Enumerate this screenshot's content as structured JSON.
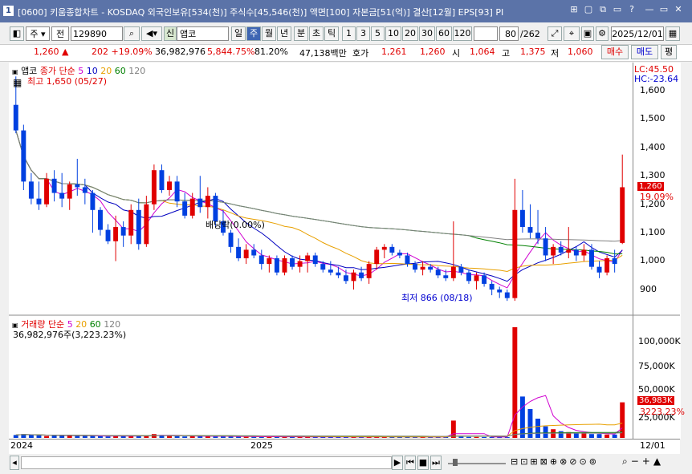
{
  "window": {
    "app_num": "1",
    "title": "[0600] 키움종합차트 - KOSDAQ 외국인보유[534(천)] 주식수[45,546(천)] 액면[100] 자본금[51(억)] 결산[12월] EPS[93] PI",
    "buttons": [
      "⊞",
      "▢",
      "⧉",
      "▭",
      "?",
      "—",
      "▭",
      "✕"
    ]
  },
  "toolbar": {
    "period_label": "주",
    "scope_label": "전",
    "code": "129890",
    "badge": "신",
    "name": "앱코",
    "periods": [
      "일",
      "주",
      "월",
      "년",
      "분",
      "초",
      "틱"
    ],
    "active_period": "주",
    "intervals": [
      "1",
      "3",
      "5",
      "10",
      "20",
      "30",
      "60",
      "120"
    ],
    "count": "80",
    "total": "/262",
    "date": "2025/12/01"
  },
  "quote": {
    "price": "1,260",
    "change": "202",
    "change_pct": "+19.09%",
    "volume": "36,982,976",
    "vol_pct": "5,844.75%",
    "ratio": "81.20%",
    "amount": "47,138백만",
    "bid_label": "호가",
    "bid1": "1,261",
    "bid2": "1,260",
    "open_label": "시",
    "open": "1,064",
    "high_label": "고",
    "high": "1,375",
    "low_label": "저",
    "low": "1,060",
    "buy": "매수",
    "sell": "매도",
    "avg": "평"
  },
  "price_panel": {
    "legend_name": "앱코",
    "legend_ma": "종가 단순",
    "ma": [
      "5",
      "10",
      "20",
      "60",
      "120"
    ],
    "ma_colors": [
      "#d000d0",
      "#0000c0",
      "#e8a000",
      "#008000",
      "#808080"
    ],
    "high_note": "최고 1,650 (05/27)",
    "low_note": "최저 866 (08/18)",
    "dividend_note": "배당락(0.00%)",
    "lc": "LC:45.50",
    "hc": "HC:-23.64",
    "yticks": [
      "1,600",
      "1,500",
      "1,400",
      "1,300",
      "1,200",
      "1,100",
      "1,000",
      "900"
    ],
    "last_price": "1,260",
    "last_pct": "19.09%"
  },
  "volume_panel": {
    "legend_name": "거래량",
    "legend_ma": "단순",
    "ma": [
      "5",
      "20",
      "60",
      "120"
    ],
    "ma_colors": [
      "#d000d0",
      "#e8a000",
      "#008000",
      "#808080"
    ],
    "vol_text": "36,982,976주(3,223.23%)",
    "yticks": [
      "100,000K",
      "75,000K",
      "50,000K",
      "25,000K"
    ],
    "last_vol": "36,983K",
    "last_pct": "3223.23%"
  },
  "xaxis": {
    "labels": [
      "2024",
      "2025"
    ],
    "right_label": "12/01"
  },
  "chart_data": {
    "type": "candlestick",
    "title": "앱코",
    "period": "weekly",
    "ylim": [
      850,
      1650
    ],
    "ohlc": [
      [
        1550,
        1650,
        1450,
        1460
      ],
      [
        1460,
        1480,
        1250,
        1280
      ],
      [
        1280,
        1310,
        1200,
        1220
      ],
      [
        1220,
        1280,
        1180,
        1200
      ],
      [
        1200,
        1310,
        1190,
        1290
      ],
      [
        1290,
        1320,
        1210,
        1240
      ],
      [
        1240,
        1310,
        1190,
        1220
      ],
      [
        1220,
        1280,
        1180,
        1270
      ],
      [
        1270,
        1360,
        1230,
        1260
      ],
      [
        1260,
        1290,
        1200,
        1240
      ],
      [
        1240,
        1250,
        1100,
        1180
      ],
      [
        1180,
        1190,
        1090,
        1110
      ],
      [
        1110,
        1130,
        1060,
        1070
      ],
      [
        1070,
        1160,
        1000,
        1120
      ],
      [
        1120,
        1140,
        1050,
        1090
      ],
      [
        1090,
        1200,
        1060,
        1180
      ],
      [
        1180,
        1220,
        1040,
        1060
      ],
      [
        1060,
        1230,
        1050,
        1200
      ],
      [
        1200,
        1340,
        1180,
        1320
      ],
      [
        1320,
        1340,
        1240,
        1250
      ],
      [
        1250,
        1300,
        1230,
        1280
      ],
      [
        1280,
        1300,
        1190,
        1210
      ],
      [
        1210,
        1240,
        1150,
        1160
      ],
      [
        1160,
        1240,
        1150,
        1220
      ],
      [
        1220,
        1300,
        1170,
        1190
      ],
      [
        1190,
        1260,
        1150,
        1230
      ],
      [
        1230,
        1240,
        1120,
        1140
      ],
      [
        1140,
        1180,
        1090,
        1100
      ],
      [
        1100,
        1110,
        1030,
        1050
      ],
      [
        1050,
        1080,
        1000,
        1010
      ],
      [
        1010,
        1060,
        990,
        1040
      ],
      [
        1040,
        1060,
        1010,
        1020
      ],
      [
        1020,
        1040,
        970,
        990
      ],
      [
        990,
        1020,
        960,
        1010
      ],
      [
        1010,
        1020,
        950,
        960
      ],
      [
        960,
        1020,
        950,
        1010
      ],
      [
        1010,
        1020,
        970,
        980
      ],
      [
        980,
        1020,
        960,
        1000
      ],
      [
        1000,
        1030,
        960,
        1020
      ],
      [
        1020,
        1030,
        980,
        990
      ],
      [
        990,
        1000,
        960,
        970
      ],
      [
        970,
        1000,
        950,
        960
      ],
      [
        960,
        980,
        940,
        950
      ],
      [
        950,
        970,
        920,
        930
      ],
      [
        930,
        970,
        900,
        960
      ],
      [
        960,
        980,
        930,
        940
      ],
      [
        940,
        1000,
        920,
        990
      ],
      [
        990,
        1050,
        970,
        1040
      ],
      [
        1040,
        1060,
        1010,
        1050
      ],
      [
        1050,
        1060,
        1020,
        1030
      ],
      [
        1030,
        1040,
        1010,
        1020
      ],
      [
        1020,
        1030,
        980,
        990
      ],
      [
        990,
        1000,
        960,
        970
      ],
      [
        970,
        1000,
        950,
        980
      ],
      [
        980,
        990,
        960,
        970
      ],
      [
        970,
        980,
        940,
        950
      ],
      [
        950,
        970,
        930,
        940
      ],
      [
        940,
        1140,
        930,
        980
      ],
      [
        980,
        990,
        950,
        960
      ],
      [
        960,
        970,
        920,
        930
      ],
      [
        930,
        960,
        900,
        950
      ],
      [
        950,
        960,
        910,
        920
      ],
      [
        920,
        930,
        880,
        900
      ],
      [
        900,
        910,
        870,
        890
      ],
      [
        890,
        900,
        860,
        870
      ],
      [
        870,
        1290,
        860,
        1180
      ],
      [
        1180,
        1250,
        1100,
        1120
      ],
      [
        1120,
        1200,
        1080,
        1100
      ],
      [
        1100,
        1180,
        1060,
        1080
      ],
      [
        1080,
        1120,
        1000,
        1020
      ],
      [
        1020,
        1060,
        990,
        1050
      ],
      [
        1050,
        1070,
        1020,
        1030
      ],
      [
        1030,
        1120,
        1010,
        1040
      ],
      [
        1040,
        1050,
        1000,
        1020
      ],
      [
        1020,
        1060,
        1000,
        1040
      ],
      [
        1040,
        1060,
        970,
        980
      ],
      [
        980,
        1000,
        940,
        960
      ],
      [
        960,
        1020,
        950,
        1010
      ],
      [
        1010,
        1040,
        960,
        990
      ],
      [
        1064,
        1375,
        1060,
        1260
      ]
    ],
    "volume_k": [
      3000,
      4000,
      3000,
      2500,
      2000,
      2500,
      3000,
      2500,
      2000,
      2000,
      2000,
      1800,
      1500,
      2500,
      2000,
      1800,
      2000,
      2500,
      4000,
      3000,
      2000,
      1800,
      1500,
      1800,
      2000,
      1800,
      1500,
      1500,
      1400,
      1300,
      1200,
      1200,
      1100,
      1500,
      1200,
      1000,
      1100,
      1000,
      1200,
      1100,
      1000,
      1000,
      900,
      900,
      1000,
      900,
      1200,
      1500,
      1200,
      1100,
      1000,
      1000,
      900,
      900,
      900,
      900,
      900,
      18000,
      1200,
      1000,
      1000,
      900,
      900,
      800,
      800,
      115000,
      43000,
      30000,
      20000,
      12000,
      9000,
      7000,
      6000,
      5000,
      5000,
      4000,
      4000,
      3500,
      3500,
      36983
    ],
    "ma_series": [
      "5",
      "10",
      "20",
      "60",
      "120"
    ]
  }
}
